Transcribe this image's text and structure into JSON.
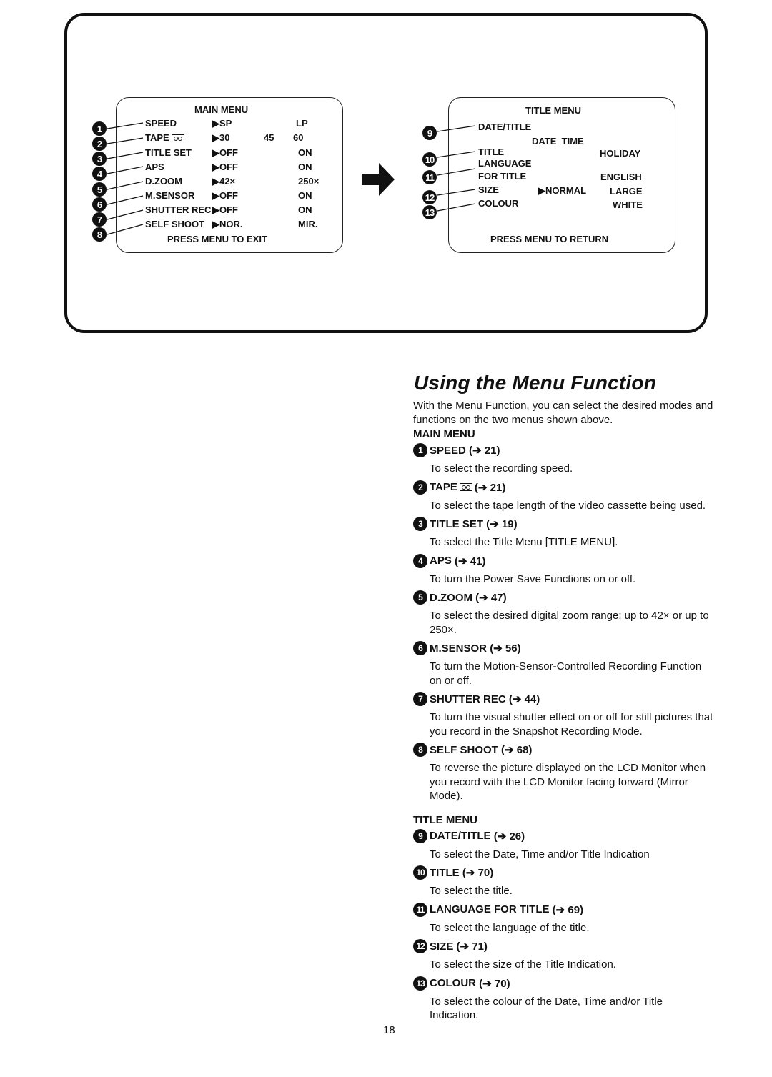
{
  "main_menu_screen": {
    "title": "MAIN MENU",
    "rows": [
      {
        "num": "1",
        "label": "SPEED",
        "options": [
          "SP",
          "",
          "LP"
        ]
      },
      {
        "num": "2",
        "label": "TAPE",
        "options": [
          "30",
          "45",
          "60"
        ]
      },
      {
        "num": "3",
        "label": "TITLE SET",
        "options": [
          "OFF",
          "",
          "ON"
        ]
      },
      {
        "num": "4",
        "label": "APS",
        "options": [
          "OFF",
          "",
          "ON"
        ]
      },
      {
        "num": "5",
        "label": "D.ZOOM",
        "options": [
          "42×",
          "",
          "250×"
        ]
      },
      {
        "num": "6",
        "label": "M.SENSOR",
        "options": [
          "OFF",
          "",
          "ON"
        ]
      },
      {
        "num": "7",
        "label": "SHUTTER REC",
        "options": [
          "OFF",
          "",
          "ON"
        ]
      },
      {
        "num": "8",
        "label": "SELF SHOOT",
        "options": [
          "NOR.",
          "",
          "MIR."
        ]
      }
    ],
    "footer": "PRESS MENU TO EXIT",
    "selector_glyph": "▶",
    "tape_icon": "cassette-icon"
  },
  "title_menu_screen": {
    "title": "TITLE MENU",
    "date_title_label": "DATE/TITLE",
    "date_title_values": "DATE  TIME",
    "title_label": "TITLE",
    "title_value": "HOLIDAY",
    "language_label_1": "LANGUAGE",
    "language_label_2": "FOR TITLE",
    "language_value": "ENGLISH",
    "size_label": "SIZE",
    "size_selected": "NORMAL",
    "size_alt": "LARGE",
    "colour_label": "COLOUR",
    "colour_value": "WHITE",
    "footer": "PRESS MENU TO RETURN",
    "nums": [
      "9",
      "10",
      "11",
      "12",
      "13"
    ]
  },
  "heading": "Using the Menu Function",
  "intro": "With the Menu Function, you can select the desired modes and functions on the two menus shown above.",
  "sections": [
    {
      "title": "MAIN MENU",
      "items": [
        {
          "num": "1",
          "name": "SPEED",
          "ref": "(➔ 21)",
          "desc": "To select the recording speed."
        },
        {
          "num": "2",
          "name": "TAPE",
          "ref": "(➔ 21)",
          "desc": "To select the tape length of the video cassette being used."
        },
        {
          "num": "3",
          "name": "TITLE SET",
          "ref": "(➔ 19)",
          "desc": "To select  the Title Menu [TITLE MENU]."
        },
        {
          "num": "4",
          "name": "APS",
          "ref": "(➔ 41)",
          "desc": "To turn the Power Save Functions on or off."
        },
        {
          "num": "5",
          "name": "D.ZOOM",
          "ref": "(➔ 47)",
          "desc": "To select the desired digital zoom range: up to 42× or up to 250×."
        },
        {
          "num": "6",
          "name": "M.SENSOR",
          "ref": "(➔ 56)",
          "desc": "To turn the Motion-Sensor-Controlled Recording Function on or off."
        },
        {
          "num": "7",
          "name": "SHUTTER REC",
          "ref": "(➔ 44)",
          "desc": "To turn the visual shutter effect on or off for still pictures that you record in the Snapshot Recording Mode."
        },
        {
          "num": "8",
          "name": "SELF SHOOT",
          "ref": "(➔ 68)",
          "desc": "To reverse the picture displayed on the LCD Monitor when you record with the LCD Monitor facing forward (Mirror Mode)."
        }
      ]
    },
    {
      "title": "TITLE MENU",
      "items": [
        {
          "num": "9",
          "name": "DATE/TITLE",
          "ref": "(➔ 26)",
          "desc": "To select the Date, Time and/or Title Indication"
        },
        {
          "num": "10",
          "name": "TITLE",
          "ref": "(➔ 70)",
          "desc": "To select the title."
        },
        {
          "num": "11",
          "name": "LANGUAGE FOR TITLE",
          "ref": "(➔ 69)",
          "desc": "To select the language of the title."
        },
        {
          "num": "12",
          "name": "SIZE",
          "ref": "(➔ 71)",
          "desc": "To select the size of the Title Indication."
        },
        {
          "num": "13",
          "name": "COLOUR",
          "ref": "(➔ 70)",
          "desc": "To select the colour of the Date, Time and/or Title Indication."
        }
      ]
    }
  ],
  "page_number": "18"
}
